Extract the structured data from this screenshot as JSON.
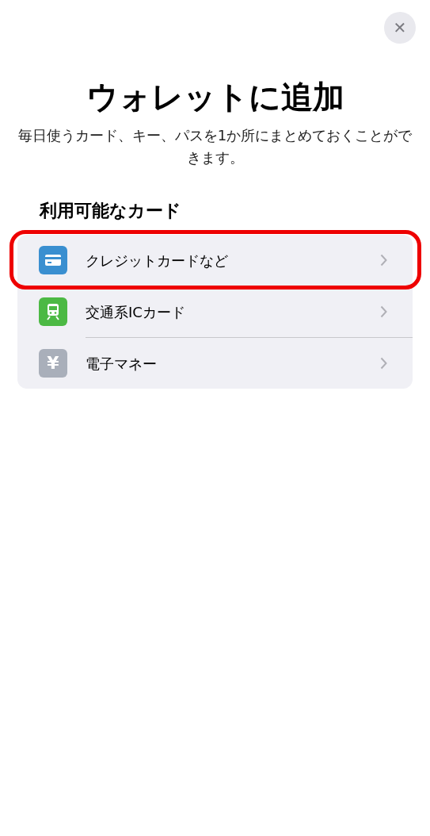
{
  "close_button": {
    "label": "✕"
  },
  "title": "ウォレットに追加",
  "subtitle": "毎日使うカード、キー、パスを1か所にまとめておくことができます。",
  "section": {
    "title": "利用可能なカード",
    "items": [
      {
        "kind": "card",
        "label": "クレジットカードなど",
        "color": "#3a8fd0",
        "highlighted": true
      },
      {
        "kind": "train",
        "label": "交通系ICカード",
        "color": "#4cb944",
        "highlighted": false
      },
      {
        "kind": "currency",
        "symbol": "¥",
        "label": "電子マネー",
        "color": "#a9afba",
        "highlighted": false
      }
    ]
  }
}
